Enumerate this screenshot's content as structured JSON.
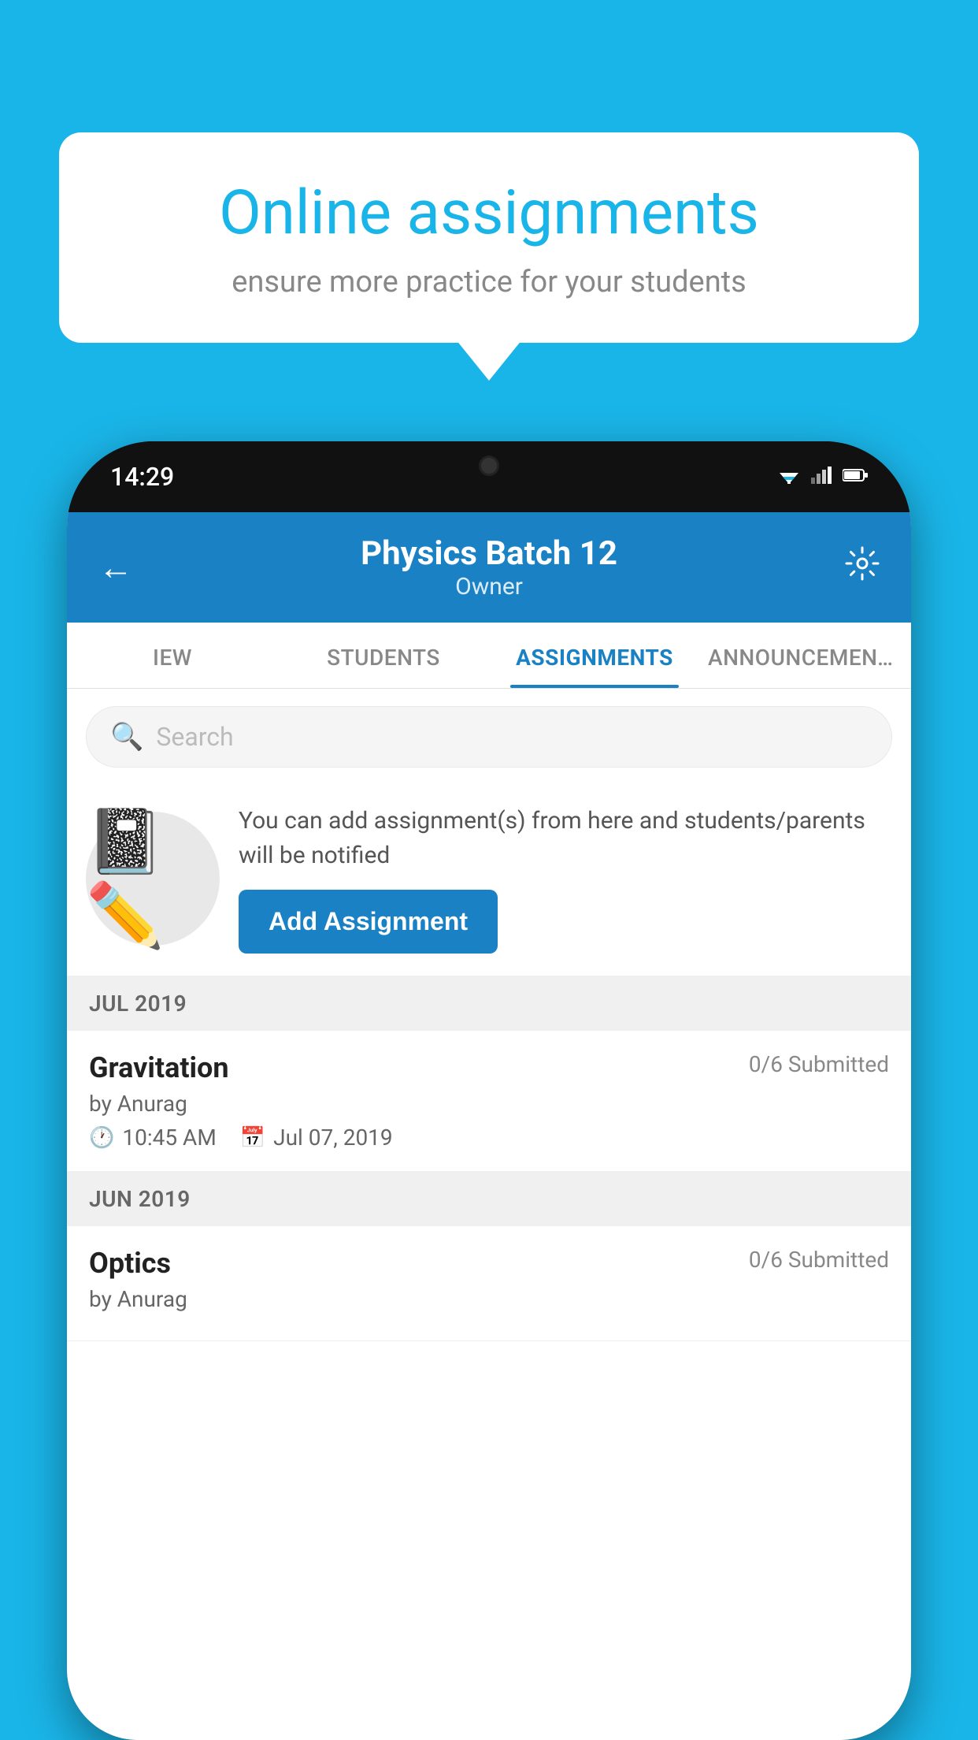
{
  "background_color": "#1ab5e8",
  "info_card": {
    "title": "Online assignments",
    "subtitle": "ensure more practice for your students"
  },
  "phone": {
    "time": "14:29",
    "header": {
      "title": "Physics Batch 12",
      "subtitle": "Owner"
    },
    "tabs": [
      {
        "label": "IEW",
        "active": false
      },
      {
        "label": "STUDENTS",
        "active": false
      },
      {
        "label": "ASSIGNMENTS",
        "active": true
      },
      {
        "label": "ANNOUNCEMENTS",
        "active": false
      }
    ],
    "search": {
      "placeholder": "Search"
    },
    "promo": {
      "description": "You can add assignment(s) from here and students/parents will be notified",
      "button_label": "Add Assignment"
    },
    "sections": [
      {
        "month_label": "JUL 2019",
        "assignments": [
          {
            "title": "Gravitation",
            "submitted": "0/6 Submitted",
            "author": "by Anurag",
            "time": "10:45 AM",
            "date": "Jul 07, 2019"
          }
        ]
      },
      {
        "month_label": "JUN 2019",
        "assignments": [
          {
            "title": "Optics",
            "submitted": "0/6 Submitted",
            "author": "by Anurag",
            "time": "",
            "date": ""
          }
        ]
      }
    ]
  }
}
